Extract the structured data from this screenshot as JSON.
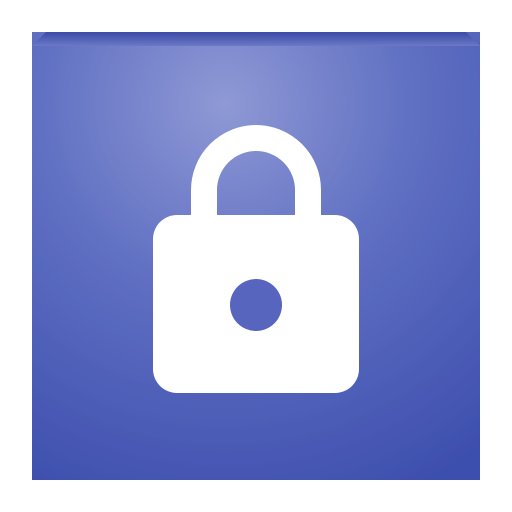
{
  "icon": {
    "name": "lock-app-icon",
    "symbol": "padlock-icon",
    "colors": {
      "background_light": "#8f99d5",
      "background_mid": "#5f6fc2",
      "background_dark": "#3e4fae",
      "top_bevel": "#6b79c7",
      "symbol": "#ffffff",
      "keyhole": "#5865bf"
    }
  }
}
